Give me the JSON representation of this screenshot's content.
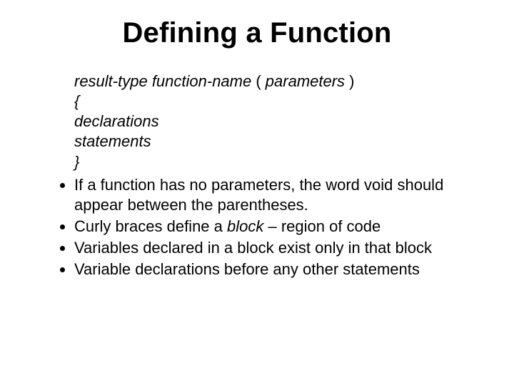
{
  "title": "Defining a Function",
  "syntax": {
    "line1_a": "result-type function-name ",
    "line1_b": "(",
    "line1_c": " parameters ",
    "line1_d": ")",
    "line2": "{",
    "line3": "declarations",
    "line4": "statements",
    "line5": "}"
  },
  "bullets": {
    "b1": "If a function has no parameters, the word void should appear between the parentheses.",
    "b2_a": "Curly braces define a ",
    "b2_b": "block",
    "b2_c": " – region of code",
    "b3": "Variables declared in a block exist only in that block",
    "b4": "Variable declarations before any other statements"
  }
}
